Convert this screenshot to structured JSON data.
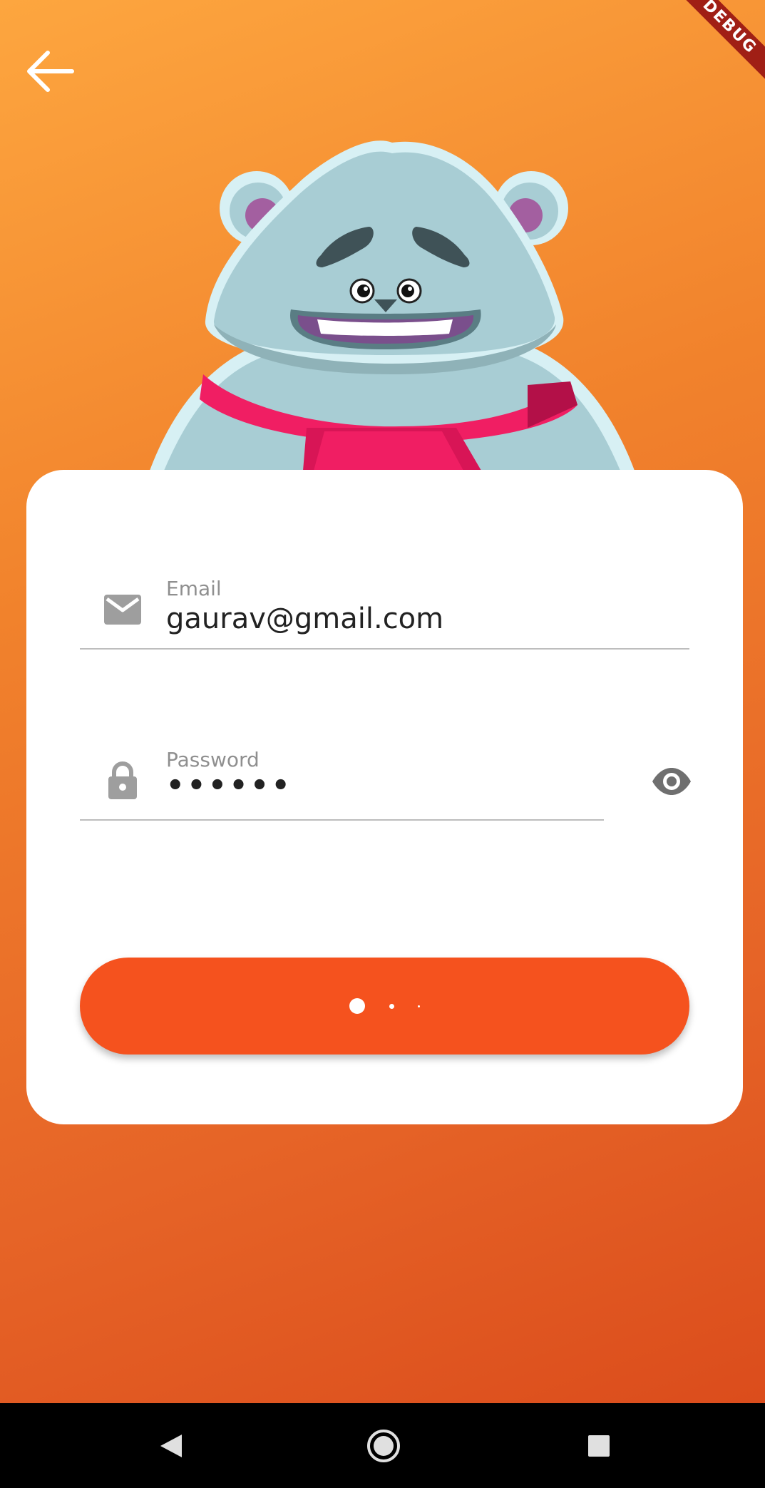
{
  "debug_banner": {
    "text": "DEBUG"
  },
  "login": {
    "email": {
      "label": "Email",
      "value": "gaurav@gmail.com",
      "icon": "email-icon"
    },
    "password": {
      "label": "Password",
      "value": "••••••",
      "icon": "lock-icon",
      "toggle_icon": "eye-icon"
    },
    "submit_button": {
      "state": "loading",
      "indicator": "three-dot-loader"
    }
  },
  "colors": {
    "accent": "#f5521e",
    "background_top": "#fda63f",
    "background_bottom": "#d9481a",
    "scarf": "#f01e63",
    "bear_fur": "#a8cdd4"
  },
  "nav": {
    "back_icon": "back-arrow-icon",
    "system_buttons": [
      "back-icon",
      "home-icon",
      "recents-icon"
    ]
  }
}
